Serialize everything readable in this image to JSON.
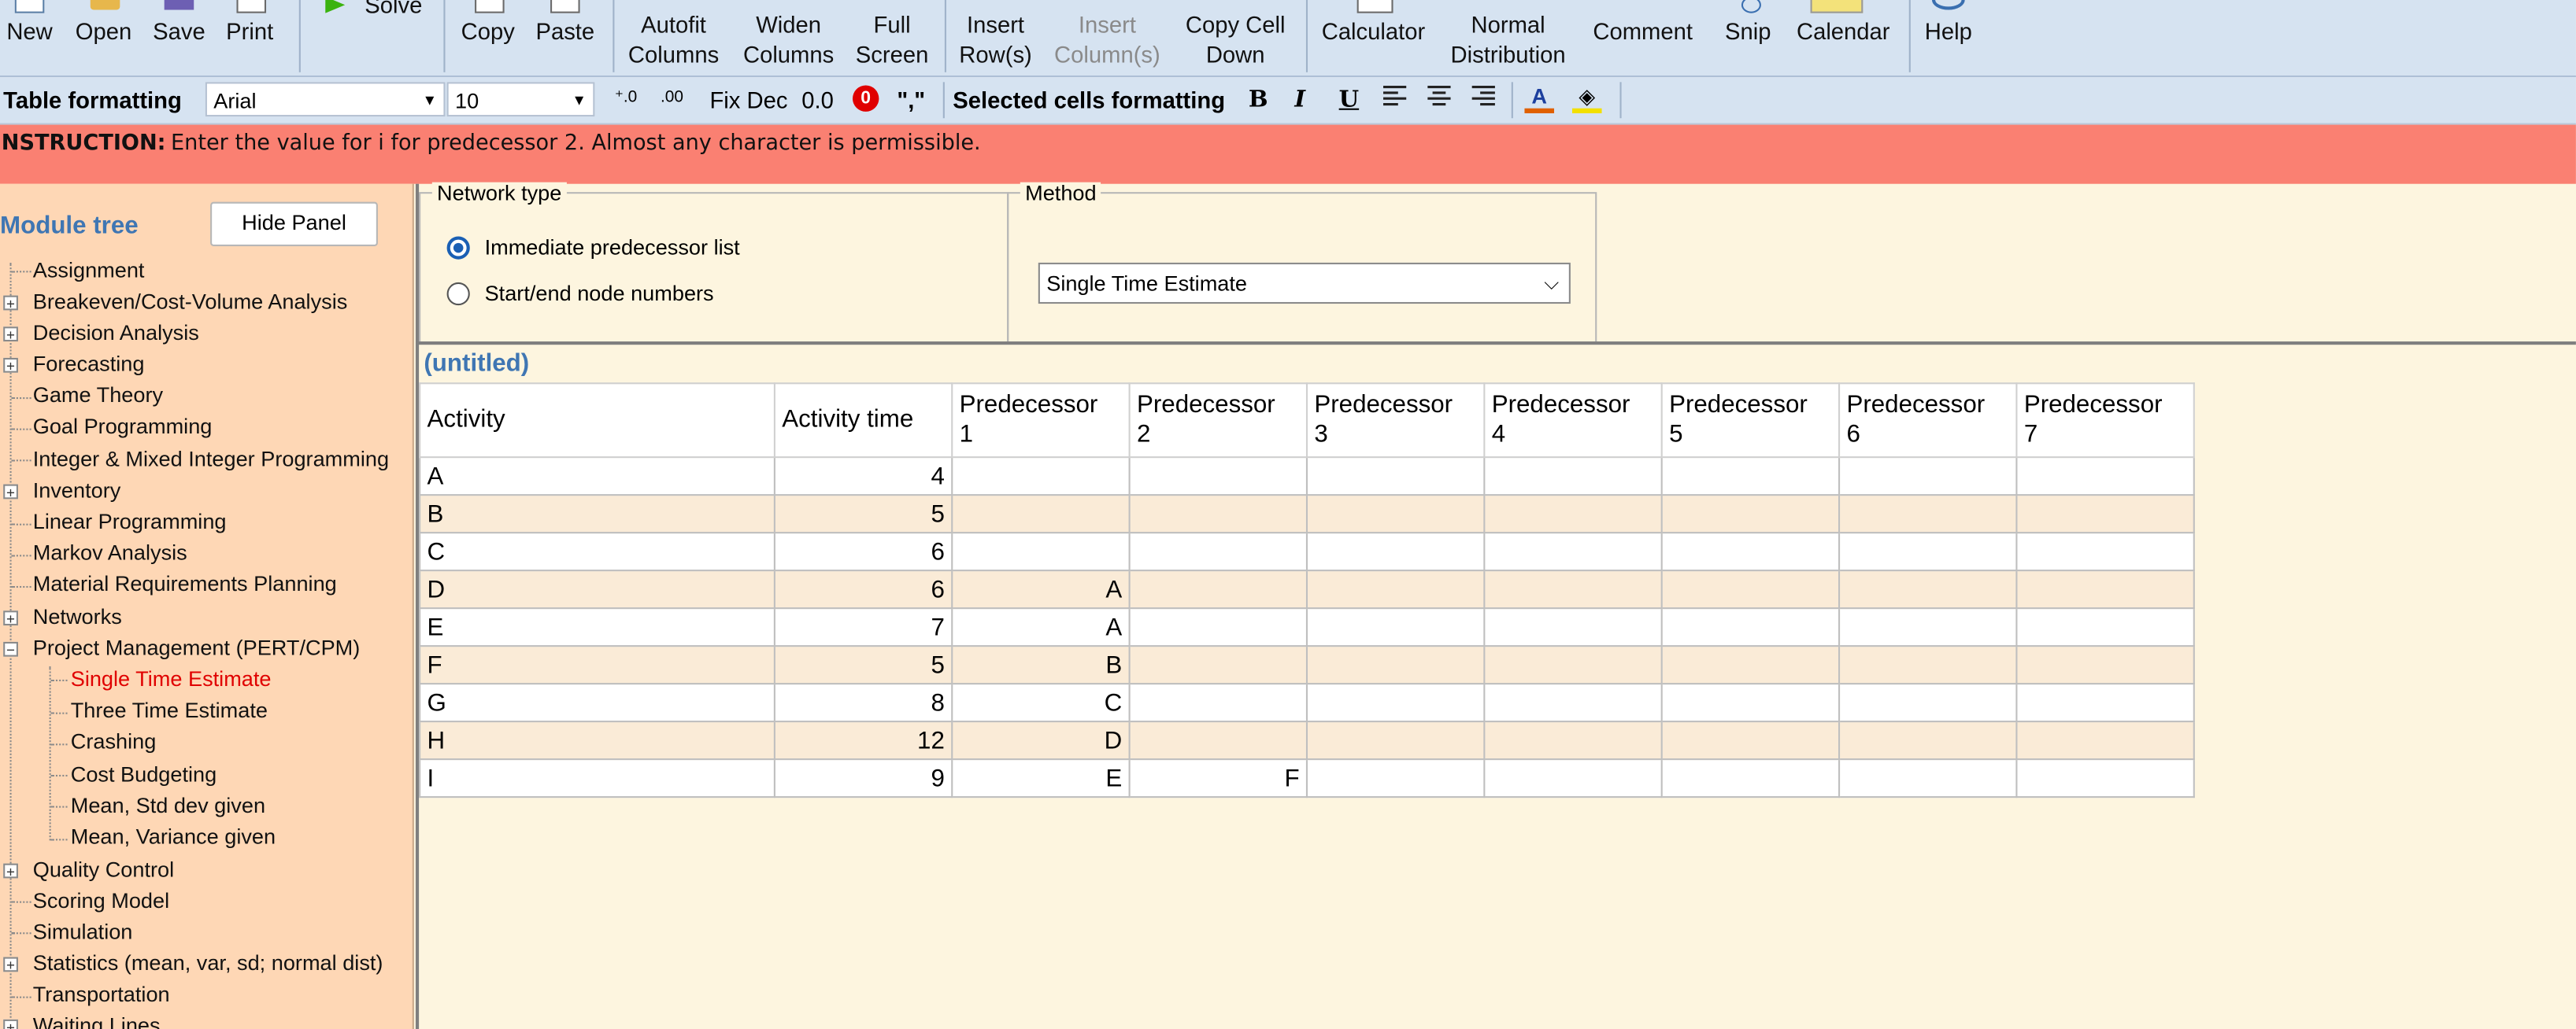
{
  "toolbar": {
    "buttons": [
      {
        "label1": "New",
        "label2": ""
      },
      {
        "label1": "Open",
        "label2": ""
      },
      {
        "label1": "Save",
        "label2": ""
      },
      {
        "label1": "Print",
        "label2": ""
      },
      {
        "label1": "Solve",
        "label2": ""
      },
      {
        "label1": "Copy",
        "label2": ""
      },
      {
        "label1": "Paste",
        "label2": ""
      },
      {
        "label1": "Autofit",
        "label2": "Columns"
      },
      {
        "label1": "Widen",
        "label2": "Columns"
      },
      {
        "label1": "Full",
        "label2": "Screen"
      },
      {
        "label1": "Insert",
        "label2": "Row(s)"
      },
      {
        "label1": "Insert",
        "label2": "Column(s)"
      },
      {
        "label1": "Copy Cell",
        "label2": "Down"
      },
      {
        "label1": "Calculator",
        "label2": ""
      },
      {
        "label1": "Normal",
        "label2": "Distribution"
      },
      {
        "label1": "Comment",
        "label2": ""
      },
      {
        "label1": "Snip",
        "label2": ""
      },
      {
        "label1": "Calendar",
        "label2": ""
      },
      {
        "label1": "Help",
        "label2": ""
      }
    ]
  },
  "format_bar": {
    "table_formatting_label": "Table formatting",
    "font_name": "Arial",
    "font_size": "10",
    "fix_dec": "Fix Dec",
    "zero_dec": "0.0",
    "comma": "\",\"",
    "selected_cells_label": "Selected cells formatting",
    "bold": "B",
    "italic": "I",
    "underline": "U"
  },
  "instruction": {
    "label": "INSTRUCTION:",
    "text": "Enter the value for i for predecessor 2. Almost any character is permissible."
  },
  "module_tree": {
    "title": "Module tree",
    "hide_button": "Hide Panel",
    "items": [
      "Assignment",
      "Breakeven/Cost-Volume Analysis",
      "Decision Analysis",
      "Forecasting",
      "Game Theory",
      "Goal Programming",
      "Integer & Mixed Integer Programming",
      "Inventory",
      "Linear Programming",
      "Markov Analysis",
      "Material Requirements Planning",
      "Networks",
      "Project Management (PERT/CPM)",
      "Single Time Estimate",
      "Three Time Estimate",
      "Crashing",
      "Cost Budgeting",
      "Mean, Std dev given",
      "Mean, Variance given",
      "Quality Control",
      "Scoring Model",
      "Simulation",
      "Statistics (mean, var, sd; normal dist)",
      "Transportation",
      "Waiting Lines"
    ]
  },
  "network_type": {
    "title": "Network type",
    "option1": "Immediate predecessor list",
    "option2": "Start/end node numbers",
    "selected": "Immediate predecessor list"
  },
  "method": {
    "title": "Method",
    "value": "Single Time Estimate"
  },
  "table": {
    "title": "(untitled)",
    "headers": [
      [
        "Activity",
        ""
      ],
      [
        "Activity time",
        ""
      ],
      [
        "Predecessor",
        "1"
      ],
      [
        "Predecessor",
        "2"
      ],
      [
        "Predecessor",
        "3"
      ],
      [
        "Predecessor",
        "4"
      ],
      [
        "Predecessor",
        "5"
      ],
      [
        "Predecessor",
        "6"
      ],
      [
        "Predecessor",
        "7"
      ]
    ],
    "rows": [
      [
        "A",
        "4",
        "",
        "",
        "",
        "",
        "",
        "",
        ""
      ],
      [
        "B",
        "5",
        "",
        "",
        "",
        "",
        "",
        "",
        ""
      ],
      [
        "C",
        "6",
        "",
        "",
        "",
        "",
        "",
        "",
        ""
      ],
      [
        "D",
        "6",
        "A",
        "",
        "",
        "",
        "",
        "",
        ""
      ],
      [
        "E",
        "7",
        "A",
        "",
        "",
        "",
        "",
        "",
        ""
      ],
      [
        "F",
        "5",
        "B",
        "",
        "",
        "",
        "",
        "",
        ""
      ],
      [
        "G",
        "8",
        "C",
        "",
        "",
        "",
        "",
        "",
        ""
      ],
      [
        "H",
        "12",
        "D",
        "",
        "",
        "",
        "",
        "",
        ""
      ],
      [
        "I",
        "9",
        "E",
        "F",
        "",
        "",
        "",
        "",
        ""
      ]
    ]
  },
  "colors": {
    "instruction_bg": "#fa8072",
    "panel_bg": "#fed7b5",
    "main_bg": "#fdf5df",
    "accent": "#3f76b3",
    "selected_item": "#e00000"
  }
}
